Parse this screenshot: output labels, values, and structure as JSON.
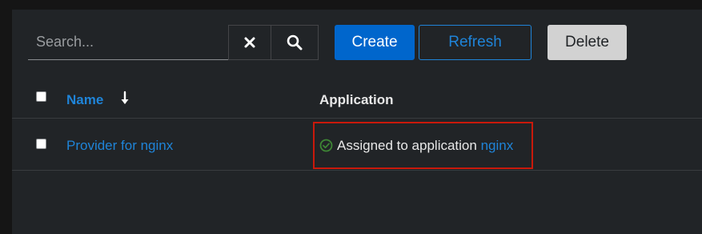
{
  "toolbar": {
    "search_placeholder": "Search...",
    "search_value": "",
    "clear_icon": "close-icon",
    "search_icon": "search-icon",
    "create_label": "Create",
    "refresh_label": "Refresh",
    "delete_label": "Delete"
  },
  "table": {
    "columns": [
      {
        "label": "Name",
        "sort": "descending",
        "sort_icon": "arrow-down-icon"
      },
      {
        "label": "Application"
      }
    ],
    "select_all_checked": false,
    "rows": [
      {
        "checked": false,
        "name": "Provider for nginx",
        "status_icon": "check-circle-icon",
        "status_text": "Assigned to application",
        "application": "nginx"
      }
    ]
  },
  "colors": {
    "background": "#151515",
    "panel": "#212427",
    "primary": "#0066cc",
    "link": "#1f84d8",
    "success": "#3e8635",
    "highlight": "#c9190b"
  }
}
